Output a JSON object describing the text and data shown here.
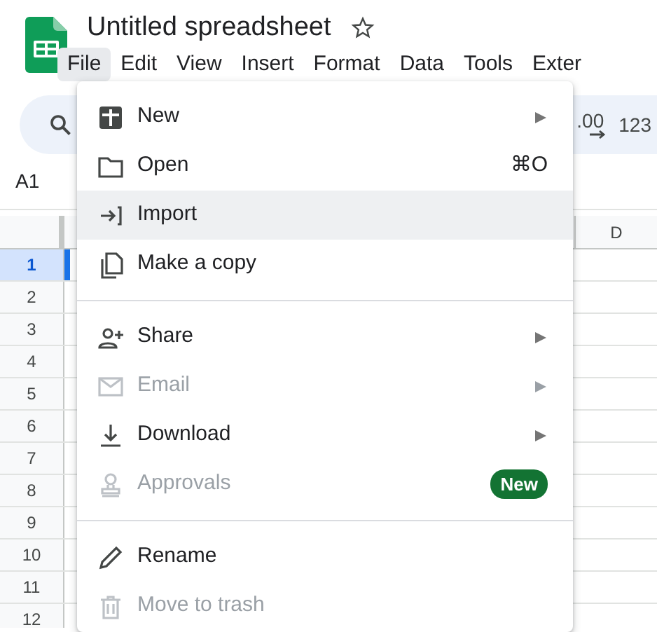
{
  "app": {
    "title": "Untitled spreadsheet",
    "starred": false
  },
  "menu_bar": [
    {
      "label": "File",
      "selected": true
    },
    {
      "label": "Edit",
      "selected": false
    },
    {
      "label": "View",
      "selected": false
    },
    {
      "label": "Insert",
      "selected": false
    },
    {
      "label": "Format",
      "selected": false
    },
    {
      "label": "Data",
      "selected": false
    },
    {
      "label": "Tools",
      "selected": false
    },
    {
      "label": "Exter",
      "selected": false
    }
  ],
  "toolbar": [
    {
      "kind": "decimal",
      "label": ".00"
    },
    {
      "kind": "number-format",
      "label": "123"
    }
  ],
  "name_box": "A1",
  "grid": {
    "columns": [
      "D"
    ],
    "rows": [
      {
        "label": "1",
        "selected": true
      },
      {
        "label": "2",
        "selected": false
      },
      {
        "label": "3",
        "selected": false
      },
      {
        "label": "4",
        "selected": false
      },
      {
        "label": "5",
        "selected": false
      },
      {
        "label": "6",
        "selected": false
      },
      {
        "label": "7",
        "selected": false
      },
      {
        "label": "8",
        "selected": false
      },
      {
        "label": "9",
        "selected": false
      },
      {
        "label": "10",
        "selected": false
      },
      {
        "label": "11",
        "selected": false
      },
      {
        "label": "12",
        "selected": false
      }
    ]
  },
  "file_menu": [
    {
      "kind": "item",
      "label": "New",
      "submenu": true,
      "disabled": false,
      "highlighted": false
    },
    {
      "kind": "item",
      "label": "Open",
      "shortcut": "⌘O",
      "submenu": false,
      "disabled": false,
      "highlighted": false
    },
    {
      "kind": "item",
      "label": "Import",
      "submenu": false,
      "disabled": false,
      "highlighted": true
    },
    {
      "kind": "item",
      "label": "Make a copy",
      "submenu": false,
      "disabled": false,
      "highlighted": false
    },
    {
      "kind": "divider"
    },
    {
      "kind": "item",
      "label": "Share",
      "submenu": true,
      "disabled": false,
      "highlighted": false
    },
    {
      "kind": "item",
      "label": "Email",
      "submenu": true,
      "disabled": true,
      "highlighted": false
    },
    {
      "kind": "item",
      "label": "Download",
      "submenu": true,
      "disabled": false,
      "highlighted": false
    },
    {
      "kind": "item",
      "label": "Approvals",
      "badge": "New",
      "submenu": false,
      "disabled": true,
      "highlighted": false
    },
    {
      "kind": "divider"
    },
    {
      "kind": "item",
      "label": "Rename",
      "submenu": false,
      "disabled": false,
      "highlighted": false
    },
    {
      "kind": "item",
      "label": "Move to trash",
      "submenu": false,
      "disabled": true,
      "highlighted": false
    }
  ]
}
